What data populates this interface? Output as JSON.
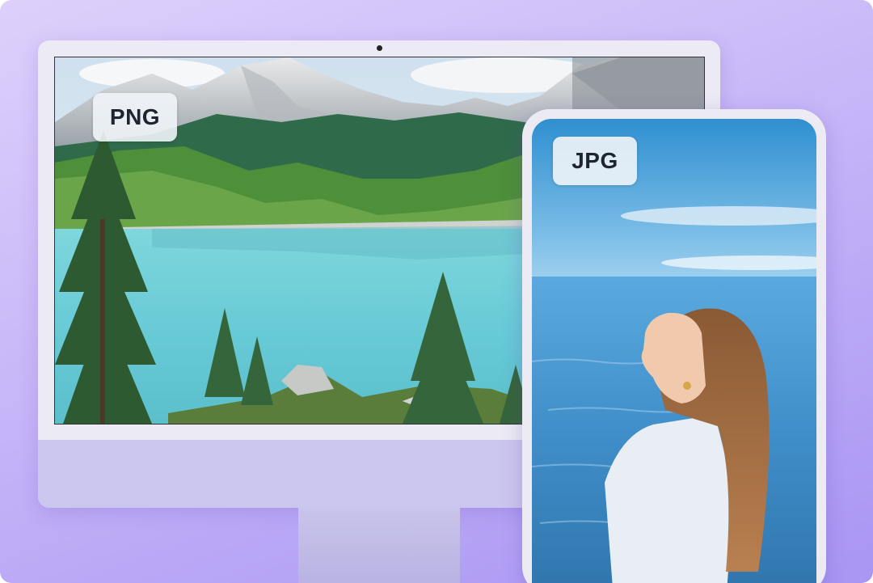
{
  "monitor": {
    "format_label": "PNG",
    "image": "mountain-lake-landscape"
  },
  "phone": {
    "format_label": "JPG",
    "image": "woman-by-the-sea"
  },
  "colors": {
    "background_top": "#ddd0fb",
    "background_bottom": "#a995f3",
    "device_frame": "#eceaf4",
    "monitor_chin": "#cbc6ee",
    "lake": "#6fd1d8",
    "sea": "#4f9fd6",
    "sky": "#6cb8e4"
  }
}
